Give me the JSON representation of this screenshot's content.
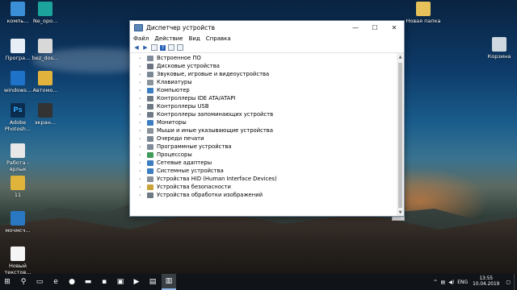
{
  "desktop": {
    "icons_left": [
      {
        "label": "компь...",
        "icon": "computer-icon",
        "color": "#3b8fd6"
      },
      {
        "label": "Ne_opo...",
        "icon": "document-icon",
        "color": "#1ca39b"
      },
      {
        "label": "Програ...",
        "icon": "window-icon",
        "color": "#e8eef5"
      },
      {
        "label": "bez_dos...",
        "icon": "file-icon",
        "color": "#d8d8d8"
      },
      {
        "label": "windows...",
        "icon": "windows-icon",
        "color": "#1e73c9"
      },
      {
        "label": "Автомо...",
        "icon": "folder-icon",
        "color": "#e2b33c"
      },
      {
        "label": "Adobe Photosh...",
        "icon": "photoshop-icon",
        "color": "#0b2d4f"
      },
      {
        "label": "экран...",
        "icon": "image-icon",
        "color": "#333333"
      },
      {
        "label": "Работа - ярлык",
        "icon": "shortcut-icon",
        "color": "#e8e8e8"
      },
      {
        "label": "11",
        "icon": "text-file-icon",
        "color": "#e0b43a"
      },
      {
        "label": "мочмсч...",
        "icon": "media-icon",
        "color": "#2a78c2"
      },
      {
        "label": "Новый текстов...",
        "icon": "text-file-icon",
        "color": "#f5f5f5"
      }
    ],
    "icons_right": [
      {
        "label": "Новая папка",
        "icon": "folder-icon",
        "color": "#e7c25a"
      },
      {
        "label": "Корзина",
        "icon": "recycle-bin-icon",
        "color": "#cfd8e0"
      }
    ]
  },
  "window": {
    "title": "Диспетчер устройств",
    "controls": {
      "minimize": "—",
      "maximize": "☐",
      "close": "✕"
    },
    "menu": [
      "Файл",
      "Действие",
      "Вид",
      "Справка"
    ],
    "toolbar_icons": [
      "back-arrow-icon",
      "forward-arrow-icon",
      "properties-icon",
      "help-icon",
      "view-icon",
      "monitor-icon"
    ],
    "tree": [
      {
        "label": "Встроенное ПО",
        "icon": "firmware-icon",
        "color": "#7f8c99"
      },
      {
        "label": "Дисковые устройства",
        "icon": "disk-icon",
        "color": "#6b7480"
      },
      {
        "label": "Звуковые, игровые и видеоустройства",
        "icon": "sound-icon",
        "color": "#7a8894"
      },
      {
        "label": "Клавиатуры",
        "icon": "keyboard-icon",
        "color": "#8a939c"
      },
      {
        "label": "Компьютер",
        "icon": "computer-icon",
        "color": "#3d7ec2"
      },
      {
        "label": "Контроллеры IDE ATA/ATAPI",
        "icon": "ide-controller-icon",
        "color": "#6f7a86"
      },
      {
        "label": "Контроллеры USB",
        "icon": "usb-icon",
        "color": "#6f7a86"
      },
      {
        "label": "Контроллеры запоминающих устройств",
        "icon": "storage-controller-icon",
        "color": "#6f7a86"
      },
      {
        "label": "Мониторы",
        "icon": "monitor-icon",
        "color": "#3d7ec2"
      },
      {
        "label": "Мыши и иные указывающие устройства",
        "icon": "mouse-icon",
        "color": "#8a939c"
      },
      {
        "label": "Очереди печати",
        "icon": "printer-icon",
        "color": "#7a8894"
      },
      {
        "label": "Программные устройства",
        "icon": "software-device-icon",
        "color": "#7f8c99"
      },
      {
        "label": "Процессоры",
        "icon": "processor-icon",
        "color": "#3e9a5a"
      },
      {
        "label": "Сетевые адаптеры",
        "icon": "network-adapter-icon",
        "color": "#3d7ec2"
      },
      {
        "label": "Системные устройства",
        "icon": "system-device-icon",
        "color": "#3d7ec2"
      },
      {
        "label": "Устройства HID (Human Interface Devices)",
        "icon": "hid-icon",
        "color": "#8a939c"
      },
      {
        "label": "Устройства безопасности",
        "icon": "security-icon",
        "color": "#c9a23a"
      },
      {
        "label": "Устройства обработки изображений",
        "icon": "camera-icon",
        "color": "#6f7a86"
      }
    ]
  },
  "taskbar": {
    "items": [
      {
        "icon": "start-icon",
        "glyph": "⊞",
        "active": false
      },
      {
        "icon": "search-icon",
        "glyph": "⚲",
        "active": false
      },
      {
        "icon": "task-view-icon",
        "glyph": "▭",
        "active": false
      },
      {
        "icon": "edge-icon",
        "glyph": "e",
        "active": false
      },
      {
        "icon": "chrome-icon",
        "glyph": "●",
        "active": false
      },
      {
        "icon": "explorer-icon",
        "glyph": "▬",
        "active": false
      },
      {
        "icon": "terminal-icon",
        "glyph": "▪",
        "active": false
      },
      {
        "icon": "photos-icon",
        "glyph": "▣",
        "active": false
      },
      {
        "icon": "media-player-icon",
        "glyph": "▶",
        "active": false
      },
      {
        "icon": "notepad-icon",
        "glyph": "▤",
        "active": false
      },
      {
        "icon": "device-manager-icon",
        "glyph": "▥",
        "active": true
      }
    ],
    "tray": {
      "caret": "^",
      "lang": "ENG",
      "time": "13:55",
      "date": "10.04.2019"
    }
  }
}
